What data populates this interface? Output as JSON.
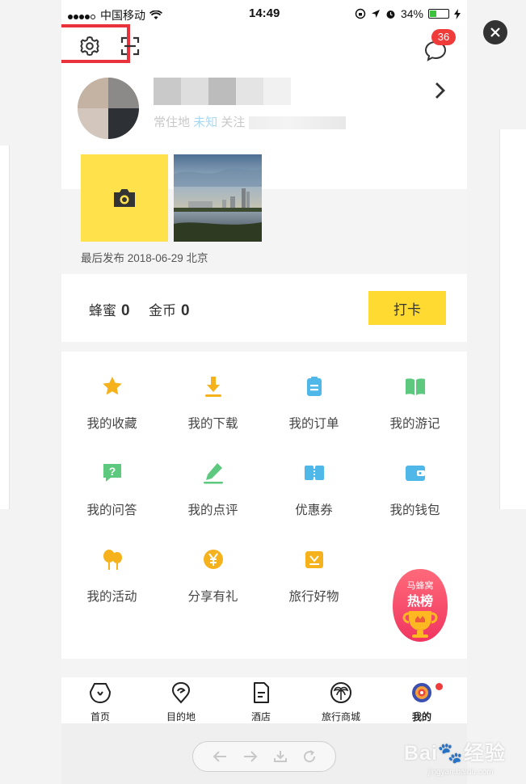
{
  "status_bar": {
    "carrier": "中国移动",
    "time": "14:49",
    "battery": "34%"
  },
  "header": {
    "message_badge": "36"
  },
  "profile": {
    "meta_resident": "常住地",
    "meta_unknown": "未知",
    "meta_follow": "关注"
  },
  "post": {
    "last_post": "最后发布 2018-06-29 北京"
  },
  "wallet": {
    "honey_label": "蜂蜜",
    "honey_value": "0",
    "coin_label": "金币",
    "coin_value": "0",
    "checkin_label": "打卡"
  },
  "menu": [
    {
      "label": "我的收藏",
      "icon": "star-icon",
      "color": "#f5b21c"
    },
    {
      "label": "我的下载",
      "icon": "download-icon",
      "color": "#f5b21c"
    },
    {
      "label": "我的订单",
      "icon": "order-icon",
      "color": "#4fb8e8"
    },
    {
      "label": "我的游记",
      "icon": "book-icon",
      "color": "#5cc97e"
    },
    {
      "label": "我的问答",
      "icon": "question-icon",
      "color": "#5cc97e"
    },
    {
      "label": "我的点评",
      "icon": "pen-icon",
      "color": "#5cc97e"
    },
    {
      "label": "优惠券",
      "icon": "coupon-icon",
      "color": "#4fb8e8"
    },
    {
      "label": "我的钱包",
      "icon": "wallet-icon",
      "color": "#4fb8e8"
    },
    {
      "label": "我的活动",
      "icon": "balloon-icon",
      "color": "#f5b21c"
    },
    {
      "label": "分享有礼",
      "icon": "yen-icon",
      "color": "#f5b21c"
    },
    {
      "label": "旅行好物",
      "icon": "goods-icon",
      "color": "#f5b21c"
    }
  ],
  "hot_badge": {
    "line1": "马蜂窝",
    "line2": "热榜"
  },
  "tabs": [
    {
      "label": "首页",
      "icon": "home-icon"
    },
    {
      "label": "目的地",
      "icon": "destination-icon"
    },
    {
      "label": "酒店",
      "icon": "hotel-icon"
    },
    {
      "label": "旅行商城",
      "icon": "mall-icon"
    },
    {
      "label": "我的",
      "icon": "me-icon"
    }
  ],
  "watermark": {
    "text": "Bai🐾经验",
    "sub": "jingyan.baidu.com"
  }
}
